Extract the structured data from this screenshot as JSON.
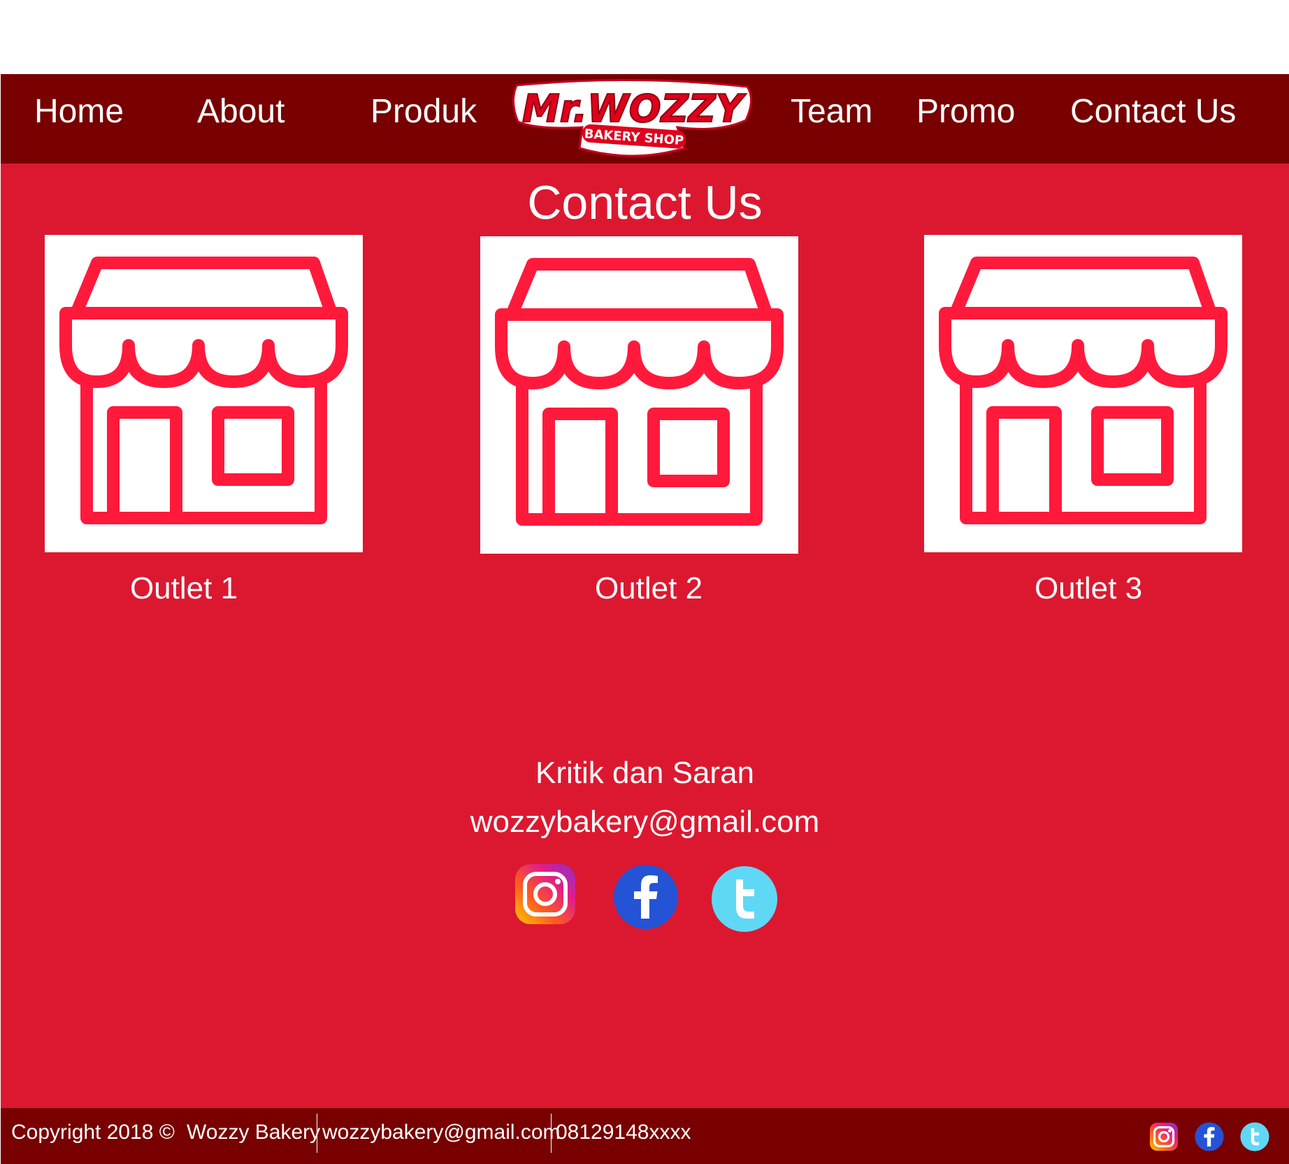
{
  "nav": {
    "items": [
      "Home",
      "About",
      "Produk",
      "Team",
      "Promo",
      "Contact Us"
    ],
    "logo_text": "Mr.WOZZY",
    "logo_subtext": "BAKERY SHOP"
  },
  "main": {
    "title": "Contact Us",
    "outlets": [
      "Outlet 1",
      "Outlet 2",
      "Outlet 3"
    ],
    "feedback_title": "Kritik dan Saran",
    "feedback_email": "wozzybakery@gmail.com",
    "social_icons": [
      "instagram-icon",
      "facebook-icon",
      "twitter-icon"
    ]
  },
  "footer": {
    "copyright": "Copyright 2018 ©",
    "company": "Wozzy Bakery",
    "email": "wozzybakery@gmail.com",
    "phone": "08129148xxxx"
  },
  "colors": {
    "nav_bg": "#780000",
    "main_bg": "#dc1830",
    "store_icon": "#ff1a3c",
    "facebook": "#2553d6",
    "twitter": "#5fd8f5"
  }
}
